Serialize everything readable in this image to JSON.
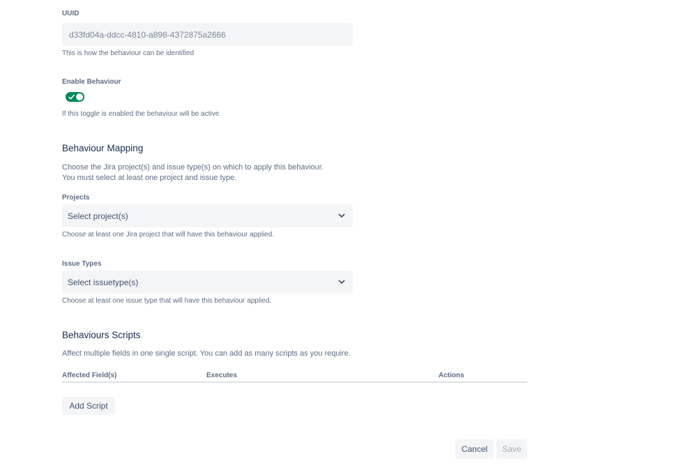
{
  "uuid": {
    "label": "UUID",
    "value": "d33fd04a-ddcc-4810-a898-4372875a2666",
    "helper": "This is how the behaviour can be identified"
  },
  "enable": {
    "label": "Enable Behaviour",
    "enabled": true,
    "helper": "If this toggle is enabled the behaviour will be active",
    "toggle_color": "#00875a"
  },
  "mapping": {
    "title": "Behaviour Mapping",
    "desc_line1": "Choose the Jira project(s) and issue type(s) on which to apply this behaviour.",
    "desc_line2": "You must select at least one project and issue type.",
    "projects": {
      "label": "Projects",
      "placeholder": "Select project(s)",
      "helper": "Choose at least one Jira project that will have this behaviour applied."
    },
    "issue_types": {
      "label": "Issue Types",
      "placeholder": "Select issuetype(s)",
      "helper": "Choose at least one issue type that will have this behaviour applied."
    }
  },
  "scripts": {
    "title": "Behaviours Scripts",
    "desc": "Affect multiple fields in one single script. You can add as many scripts as you require.",
    "columns": [
      "Affected Field(s)",
      "Executes",
      "Actions"
    ],
    "add_label": "Add Script"
  },
  "footer": {
    "cancel_label": "Cancel",
    "save_label": "Save"
  }
}
